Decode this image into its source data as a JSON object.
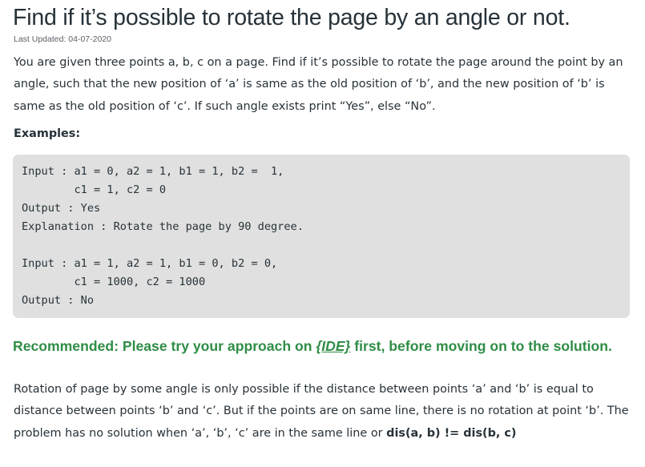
{
  "article": {
    "title": "Find if it’s possible to rotate the page by an angle or not.",
    "last_updated": "Last Updated: 04-07-2020",
    "intro": "You are given three points a, b, c on a page. Find if it’s possible to rotate the page around the point by an angle, such that the new position of ‘a’ is same as the old position of ‘b’, and the new position of ‘b’ is same as the old position of ‘c’. If such angle exists print “Yes”, else “No”.",
    "examples_heading": "Examples:",
    "code_lines": [
      "Input : a1 = 0, a2 = 1, b1 = 1, b2 =  1,",
      "        c1 = 1, c2 = 0",
      "Output : Yes",
      "Explanation : Rotate the page by 90 degree.",
      "",
      "Input : a1 = 1, a2 = 1, b1 = 0, b2 = 0,",
      "        c1 = 1000, c2 = 1000",
      "Output : No"
    ],
    "recommend_prefix": "Recommended: Please try your approach on ",
    "recommend_link": "{IDE}",
    "recommend_suffix": " first, before moving on to the solution.",
    "solution_text": "Rotation of page by some angle is only possible if the distance between points ‘a’ and ‘b’ is equal to distance between points ‘b’ and ‘c’. But if the points are on same line, there is no rotation at point ‘b’. The problem has no solution when ‘a’, ‘b’, ‘c’ are in the same line or ",
    "solution_condition": "dis(a, b) != dis(b, c)"
  },
  "colors": {
    "text": "#273239",
    "accent_green": "#2f8d46",
    "code_background": "#e0e0e0"
  }
}
